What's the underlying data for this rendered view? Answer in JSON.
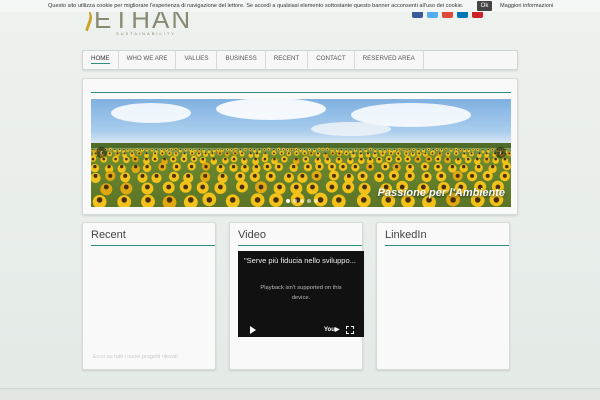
{
  "cookie": {
    "text": "Questo sito utilizza cookie per migliorare l'esperienza di navigazione del lettore. Se accedi a qualsiasi elemento sottostante questo banner acconsenti all'uso dei cookie.",
    "ok_label": "Ok",
    "more_label": "Maggiori informazioni"
  },
  "logo": {
    "name": "ETHAN",
    "tagline": "SUSTAINABILITY"
  },
  "social": {
    "colors": [
      "#3b5998",
      "#55acee",
      "#dd4b39",
      "#0077b5",
      "#cc2127"
    ]
  },
  "nav": {
    "items": [
      {
        "label": "HOME"
      },
      {
        "label": "WHO WE ARE"
      },
      {
        "label": "VALUES"
      },
      {
        "label": "BUSINESS"
      },
      {
        "label": "RECENT"
      },
      {
        "label": "CONTACT"
      },
      {
        "label": "RESERVED AREA"
      }
    ]
  },
  "slider": {
    "caption": "Passione per l'Ambiente",
    "slide_count": 5,
    "active_slide": 1
  },
  "widgets": {
    "recent": {
      "title": "Recent",
      "faded_text": "Ecco su tutti i nuovi progetti rilevati"
    },
    "video": {
      "title": "Video",
      "video_title": "\"Serve più fiducia nello sviluppo...",
      "message_line1": "Playback isn't supported on this",
      "message_line2": "device."
    },
    "linkedin": {
      "title": "LinkedIn"
    }
  },
  "colors": {
    "accent": "#2f8f7e"
  }
}
